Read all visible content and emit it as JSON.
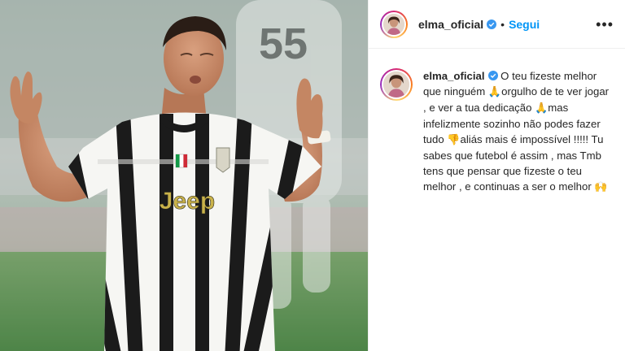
{
  "post": {
    "username": "elma_oficial",
    "follow_label": "Segui",
    "separator": "•",
    "more_label": "•••"
  },
  "caption": {
    "username": "elma_oficial",
    "segment_1": " O teu fizeste melhor que ninguém ",
    "emoji_1": "🙏",
    "segment_2": "orgulho de te ver jogar , e ver a tua dedicação ",
    "emoji_2": "🙏",
    "segment_3": "mas infelizmente sozinho não podes fazer tudo ",
    "emoji_3": "👎",
    "segment_4": "aliás mais é impossível !!!!! Tu sabes que futebol é assim , mas Tmb tens que pensar que fizeste o teu melhor , e continuas a ser o melhor ",
    "emoji_4": "🙌"
  },
  "photo": {
    "jersey_sponsor": "Jeep",
    "background_number": "55"
  },
  "colors": {
    "follow_blue": "#0095f6",
    "verified_blue": "#3897f0",
    "text": "#262626",
    "jersey_stripe": "#1a1a1a",
    "emoji_gold": "#f4b400"
  }
}
